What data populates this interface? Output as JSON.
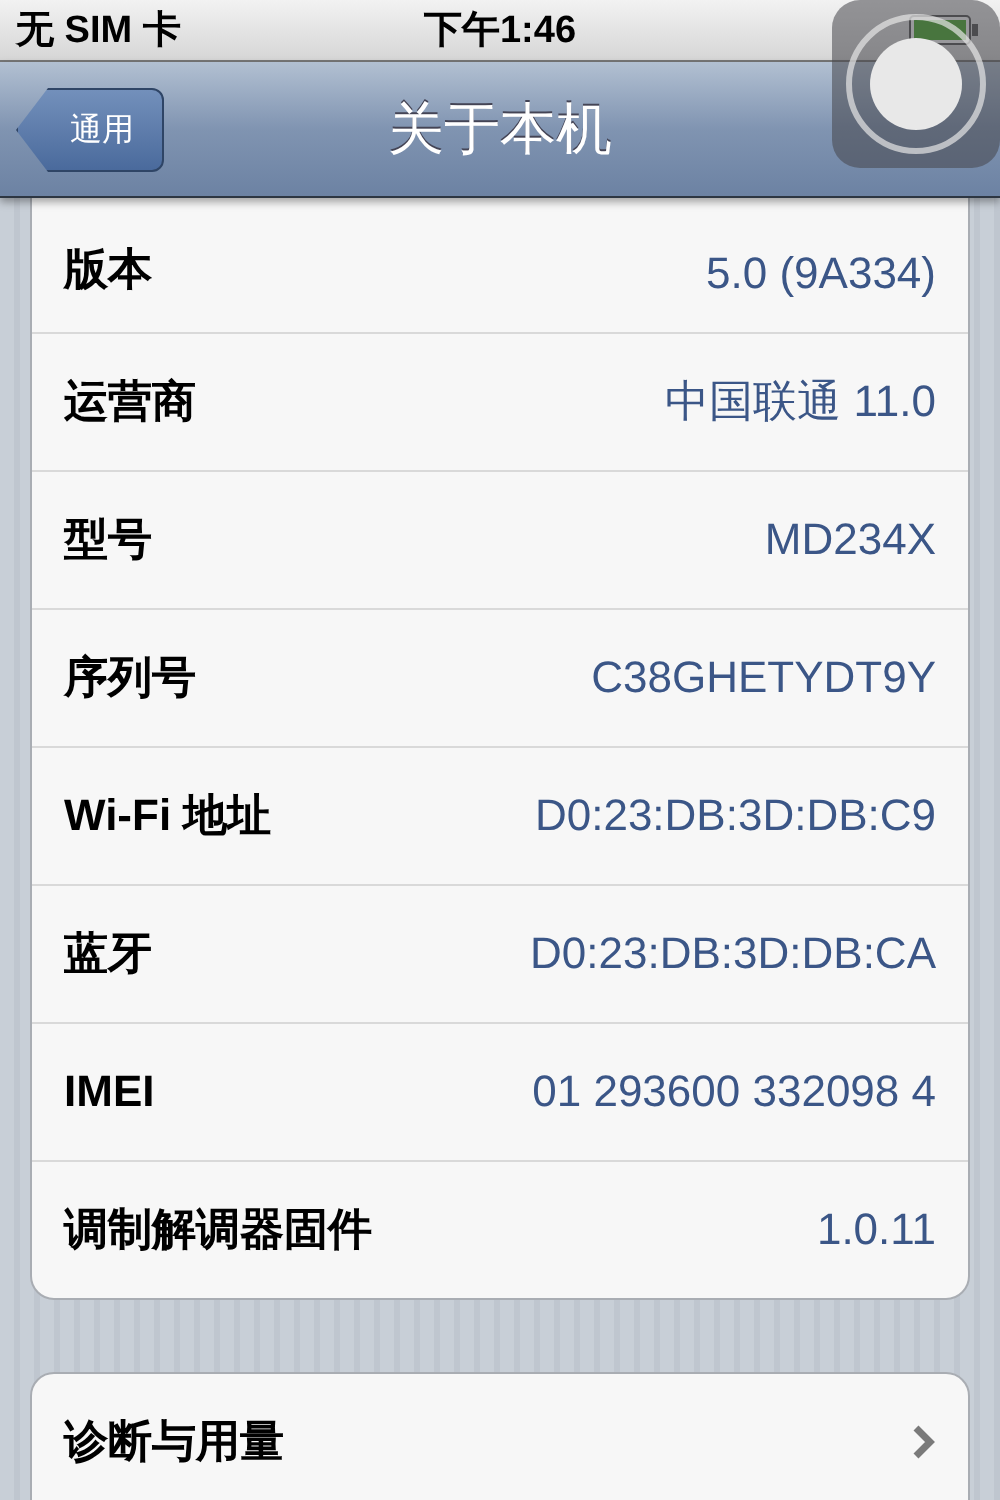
{
  "status_bar": {
    "carrier": "无 SIM 卡",
    "time": "下午1:46"
  },
  "nav_bar": {
    "back_button": "通用",
    "title": "关于本机"
  },
  "info_rows": [
    {
      "label": "版本",
      "value": "5.0 (9A334)"
    },
    {
      "label": "运营商",
      "value": "中国联通 11.0"
    },
    {
      "label": "型号",
      "value": "MD234X"
    },
    {
      "label": "序列号",
      "value": "C38GHETYDT9Y"
    },
    {
      "label": "Wi-Fi 地址",
      "value": "D0:23:DB:3D:DB:C9"
    },
    {
      "label": "蓝牙",
      "value": "D0:23:DB:3D:DB:CA"
    },
    {
      "label": "IMEI",
      "value": "01 293600 332098 4"
    },
    {
      "label": "调制解调器固件",
      "value": "1.0.11"
    }
  ],
  "link_rows": [
    {
      "label": "诊断与用量"
    }
  ]
}
